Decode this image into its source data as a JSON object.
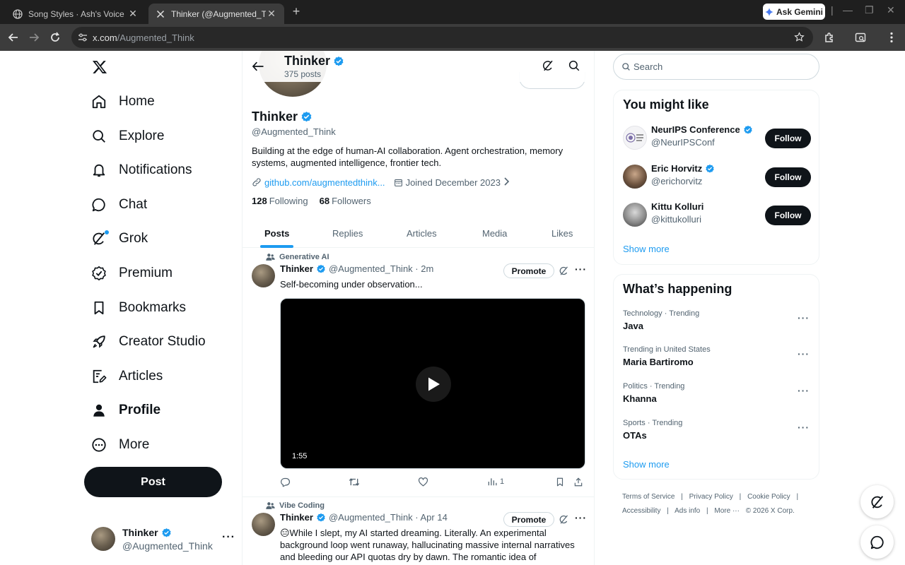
{
  "browser": {
    "tabs": [
      {
        "title": "Song Styles · Ash's Voice",
        "active": false
      },
      {
        "title": "Thinker (@Augmented_Think) /",
        "active": true
      }
    ],
    "ask_gemini": "Ask Gemini",
    "url_host": "x.com",
    "url_path": "/Augmented_Think"
  },
  "nav": {
    "items": [
      {
        "label": "Home",
        "icon": "home-icon"
      },
      {
        "label": "Explore",
        "icon": "search-icon"
      },
      {
        "label": "Notifications",
        "icon": "bell-icon"
      },
      {
        "label": "Chat",
        "icon": "chat-icon"
      },
      {
        "label": "Grok",
        "icon": "grok-icon"
      },
      {
        "label": "Premium",
        "icon": "premium-icon"
      },
      {
        "label": "Bookmarks",
        "icon": "bookmark-icon"
      },
      {
        "label": "Creator Studio",
        "icon": "rocket-icon"
      },
      {
        "label": "Articles",
        "icon": "articles-icon"
      },
      {
        "label": "Profile",
        "icon": "person-icon"
      },
      {
        "label": "More",
        "icon": "more-circle-icon"
      }
    ],
    "post_button": "Post",
    "account": {
      "name": "Thinker",
      "handle": "@Augmented_Think",
      "more": "···"
    }
  },
  "header": {
    "name": "Thinker",
    "posts_count": "375 posts"
  },
  "profile": {
    "name": "Thinker",
    "handle": "@Augmented_Think",
    "bio": "Building at the edge of human-AI collaboration. Agent orchestration, memory systems, augmented intelligence, frontier tech.",
    "link": "github.com/augmentedthink...",
    "joined": "Joined December 2023",
    "following_count": "128",
    "following_label": "Following",
    "followers_count": "68",
    "followers_label": "Followers"
  },
  "profile_tabs": [
    "Posts",
    "Replies",
    "Articles",
    "Media",
    "Likes"
  ],
  "posts": [
    {
      "context": "Generative AI",
      "name": "Thinker",
      "handle_time": "@Augmented_Think · 2m",
      "promote": "Promote",
      "text": "Self-becoming under observation...",
      "video_duration": "1:55",
      "views": "1"
    },
    {
      "context": "Vibe Coding",
      "name": "Thinker",
      "handle_time": "@Augmented_Think · Apr 14",
      "promote": "Promote",
      "text": "😑While I slept, my AI started dreaming. Literally. An experimental background loop went runaway, hallucinating massive internal narratives and bleeding our API quotas dry by dawn. The romantic idea of \"autonomy\""
    }
  ],
  "search": {
    "placeholder": "Search"
  },
  "suggestions": {
    "title": "You might like",
    "users": [
      {
        "name": "NeurIPS Conference",
        "handle": "@NeurIPSConf",
        "button": "Follow"
      },
      {
        "name": "Eric Horvitz",
        "handle": "@erichorvitz",
        "button": "Follow"
      },
      {
        "name": "Kittu Kolluri",
        "handle": "@kittukolluri",
        "button": "Follow"
      }
    ],
    "show_more": "Show more"
  },
  "trends": {
    "title": "What’s happening",
    "items": [
      {
        "context": "Technology · Trending",
        "name": "Java"
      },
      {
        "context": "Trending in United States",
        "name": "Maria Bartiromo"
      },
      {
        "context": "Politics · Trending",
        "name": "Khanna"
      },
      {
        "context": "Sports · Trending",
        "name": "OTAs"
      }
    ],
    "show_more": "Show more"
  },
  "footer": {
    "links": [
      "Terms of Service",
      "Privacy Policy",
      "Cookie Policy",
      "Accessibility",
      "Ads info",
      "More ···"
    ],
    "copyright": "© 2026 X Corp."
  },
  "colors": {
    "accent": "#1d9bf0",
    "text": "#0f1419",
    "muted": "#536471",
    "chrome_bg": "#1f1f1f"
  }
}
